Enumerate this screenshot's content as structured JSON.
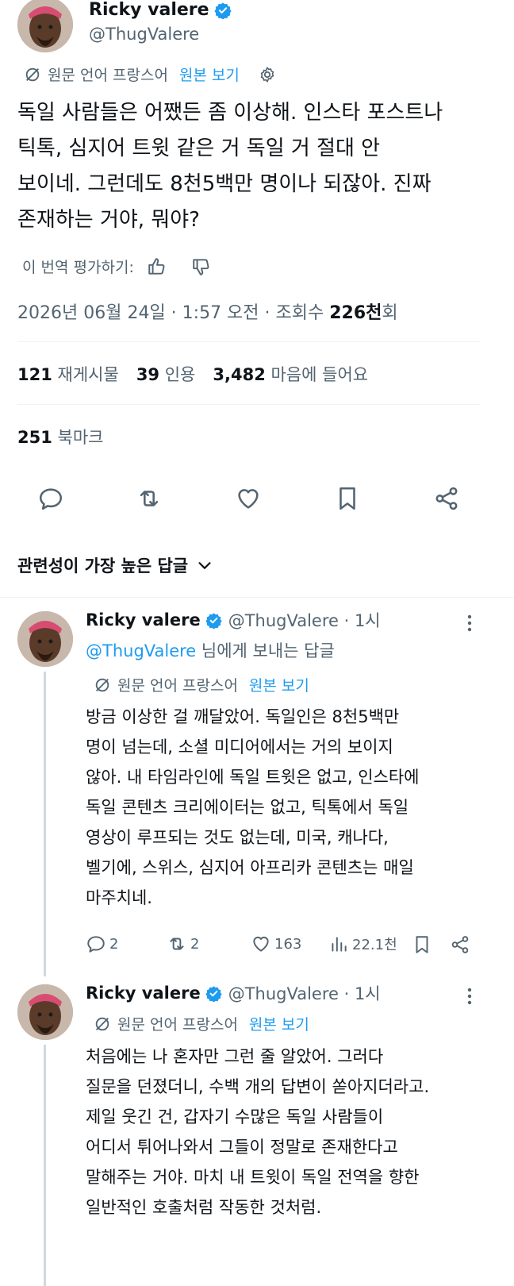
{
  "tweet": {
    "author_name": "Ricky valere",
    "handle": "@ThugValere",
    "translation_note": "원문 언어 프랑스어",
    "show_original": "원본 보기",
    "body": "독일 사람들은 어쨌든 좀 이상해. 인스타 포스트나\n틱톡, 심지어 트윗 같은 거 독일 거 절대 안\n보이네. 그런데도 8천5백만 명이나 되잖아. 진짜\n존재하는 거야, 뭐야?",
    "rate_translation": "이 번역 평가하기:",
    "timestamp": "2026년 06월 24일 · 1:57 오전 · 조회수 ",
    "views_count": "226천",
    "views_suffix": "회",
    "stats": {
      "retweets_count": "121",
      "retweets_label": "재게시물",
      "quotes_count": "39",
      "quotes_label": "인용",
      "likes_count": "3,482",
      "likes_label": "마음에 들어요",
      "bookmarks_count": "251",
      "bookmarks_label": "북마크"
    }
  },
  "sort": {
    "label": "관련성이 가장 높은 답글"
  },
  "replies": [
    {
      "author_name": "Ricky valere",
      "handle_time": "@ThugValere · 1시",
      "reply_to_handle": "@ThugValere",
      "reply_to_suffix": " 님에게 보내는 답글",
      "translation_note": "원문 언어 프랑스어",
      "show_original": "원본 보기",
      "body": "방금 이상한 걸 깨달았어. 독일인은 8천5백만\n명이 넘는데, 소셜 미디어에서는 거의 보이지\n않아. 내 타임라인에 독일 트윗은 없고, 인스타에\n독일 콘텐츠 크리에이터는 없고, 틱톡에서 독일\n영상이 루프되는 것도 없는데, 미국, 캐나다,\n벨기에, 스위스, 심지어 아프리카 콘텐츠는 매일\n마주치네.",
      "replies": "2",
      "reposts": "2",
      "likes": "163",
      "views": "22.1천"
    },
    {
      "author_name": "Ricky valere",
      "handle_time": "@ThugValere · 1시",
      "translation_note": "원문 언어 프랑스어",
      "show_original": "원본 보기",
      "body": "처음에는 나 혼자만 그런 줄 알았어. 그러다\n질문을 던졌더니, 수백 개의 답변이 쏟아지더라고.\n제일 웃긴 건, 갑자기 수많은 독일 사람들이\n어디서 튀어나와서 그들이 정말로 존재한다고\n말해주는 거야. 마치 내 트윗이 독일 전역을 향한\n일반적인 호출처럼 작동한 것처럼."
    }
  ],
  "colors": {
    "accent": "#1d9bf0",
    "text": "#0f1419",
    "secondary": "#536471",
    "divider": "#eff3f4"
  }
}
